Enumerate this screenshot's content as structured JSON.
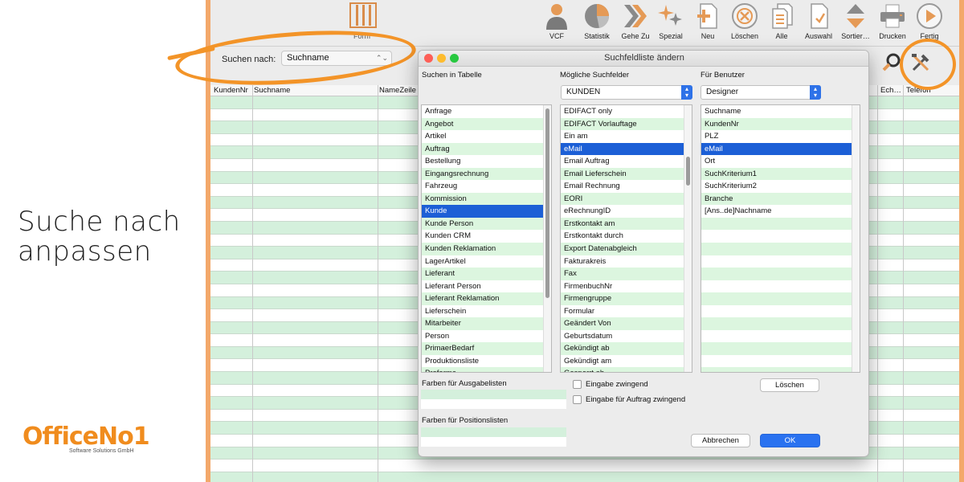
{
  "caption": {
    "line1": "Suche nach",
    "line2": "anpassen"
  },
  "logo": {
    "name": "OfficeNo1",
    "subtitle": "Software Solutions GmbH"
  },
  "toolbar": {
    "partial_label": "Form",
    "items": [
      {
        "label": "VCF",
        "icon": "person-icon"
      },
      {
        "label": "Statistik",
        "icon": "pie-chart-icon"
      },
      {
        "label": "Gehe Zu",
        "icon": "double-chevron-icon"
      },
      {
        "label": "Spezial",
        "icon": "sparkle-icon"
      },
      {
        "label": "Neu",
        "icon": "new-document-icon"
      },
      {
        "label": "Löschen",
        "icon": "delete-circle-icon"
      },
      {
        "label": "Alle",
        "icon": "documents-icon"
      },
      {
        "label": "Auswahl",
        "icon": "selection-icon"
      },
      {
        "label": "Sortier…",
        "icon": "sort-arrows-icon"
      },
      {
        "label": "Drucken",
        "icon": "printer-icon"
      },
      {
        "label": "Fertig",
        "icon": "play-circle-icon"
      }
    ]
  },
  "search": {
    "label": "Suchen nach:",
    "value": "Suchname"
  },
  "table": {
    "columns": [
      "KundenNr",
      "Suchname",
      "NameZeile",
      "Ech…",
      "Telefon"
    ]
  },
  "dialog": {
    "title": "Suchfeldliste ändern",
    "col1_header": "Suchen in Tabelle",
    "col2_header": "Mögliche Suchfelder",
    "col3_header": "Für Benutzer",
    "col2_combo": "KUNDEN",
    "col3_combo": "Designer",
    "tables": [
      "Anfrage",
      "Angebot",
      "Artikel",
      "Auftrag",
      "Bestellung",
      "Eingangsrechnung",
      "Fahrzeug",
      "Kommission",
      "Kunde",
      "Kunde Person",
      "Kunden CRM",
      "Kunden Reklamation",
      "LagerArtikel",
      "Lieferant",
      "Lieferant Person",
      "Lieferant Reklamation",
      "Lieferschein",
      "Mitarbeiter",
      "Person",
      "PrimaerBedarf",
      "Produktionsliste",
      "Proforma"
    ],
    "tables_selected": "Kunde",
    "fields": [
      "EDIFACT only",
      "EDIFACT Vorlauftage",
      "Ein am",
      "eMail",
      "Email Auftrag",
      "Email Lieferschein",
      "Email Rechnung",
      "EORI",
      "eRechnungID",
      "Erstkontakt am",
      "Erstkontakt durch",
      "Export Datenabgleich",
      "Fakturakreis",
      "Fax",
      "FirmenbuchNr",
      "Firmengruppe",
      "Formular",
      "Geändert Von",
      "Geburtsdatum",
      "Gekündigt ab",
      "Gekündigt am",
      "Gesperrt ab"
    ],
    "fields_selected": "eMail",
    "user_fields": [
      "Suchname",
      "KundenNr",
      "PLZ",
      "eMail",
      "Ort",
      "SuchKriterium1",
      "SuchKriterium2",
      "Branche",
      "[Ans..de]Nachname"
    ],
    "user_fields_selected": "eMail",
    "colors_output_label": "Farben für Ausgabelisten",
    "colors_position_label": "Farben für Positionslisten",
    "checkbox1": "Eingabe zwingend",
    "checkbox2": "Eingabe für Auftrag zwingend",
    "delete_button": "Löschen",
    "cancel_button": "Abbrechen",
    "ok_button": "OK"
  },
  "colors": {
    "accent": "#f39428",
    "selection": "#1c5fd6",
    "row_green": "#dcf6df"
  }
}
